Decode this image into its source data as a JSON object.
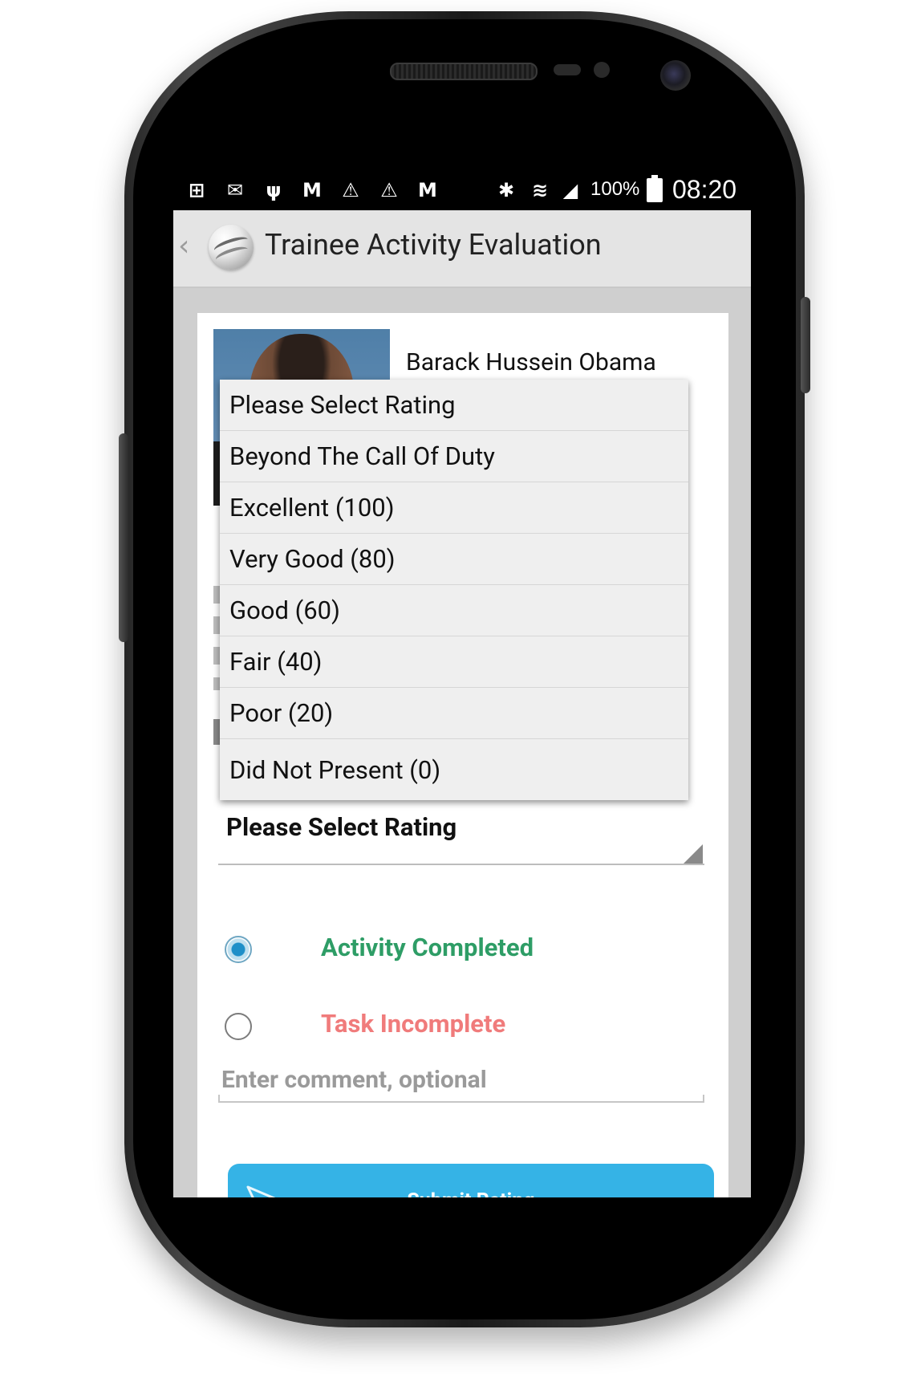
{
  "status_bar": {
    "icons": [
      "add-notification-icon",
      "mail-icon",
      "usb-icon",
      "gmail-icon",
      "warning-icon",
      "warning-icon",
      "gmail-icon",
      "bluetooth-icon",
      "wifi-icon",
      "signal-icon"
    ],
    "battery": "100%",
    "time": "08:20"
  },
  "action_bar": {
    "title": "Trainee Activity Evaluation"
  },
  "trainee": {
    "name": "Barack Hussein Obama"
  },
  "rating_select": {
    "selected": "Please Select Rating",
    "options": [
      "Please Select Rating",
      "Beyond The Call Of Duty",
      "Excellent (100)",
      "Very Good (80)",
      "Good (60)",
      "Fair (40)",
      "Poor (20)",
      "Did Not Present (0)"
    ]
  },
  "status_options": {
    "completed": "Activity Completed",
    "incomplete": "Task Incomplete",
    "selected": "completed",
    "completed_color": "#2e9d66",
    "incomplete_color": "#f07b7b"
  },
  "comment": {
    "placeholder": "Enter comment, optional"
  },
  "submit": {
    "label": "Submit Rating",
    "color": "#35b3e6"
  }
}
